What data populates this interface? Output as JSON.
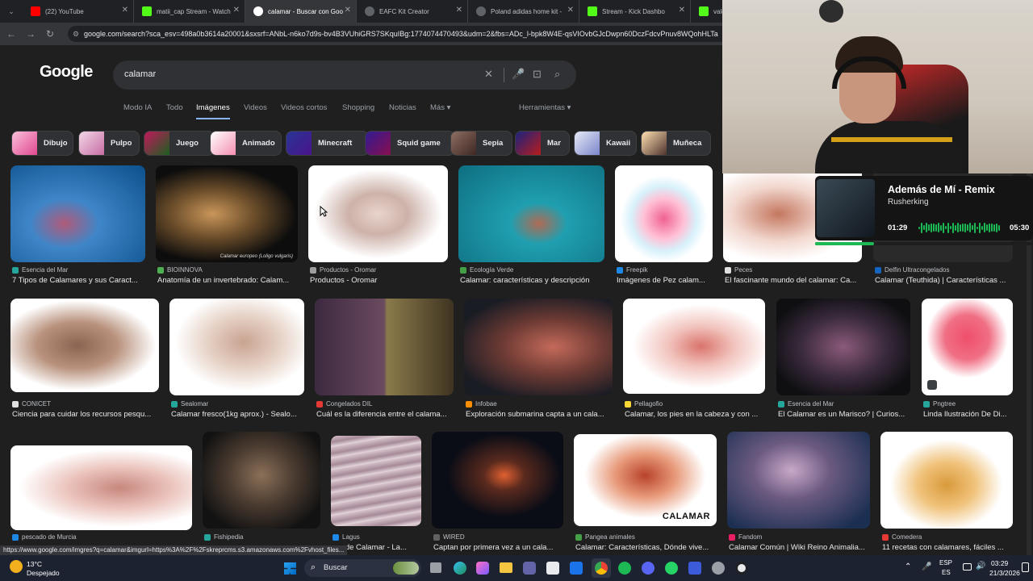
{
  "browser": {
    "tabs": [
      {
        "label": "(22) YouTube",
        "color": "#ff0000"
      },
      {
        "label": "matii_cap Stream - Watch",
        "color": "#53fc18"
      },
      {
        "label": "calamar - Buscar con Goo",
        "color": "#4285f4",
        "active": true
      },
      {
        "label": "EAFC Kit Creator",
        "color": "#9aa0a6"
      },
      {
        "label": "Poland adidas home kit -",
        "color": "#9aa0a6"
      },
      {
        "label": "Stream - Kick Dashbo",
        "color": "#53fc18"
      },
      {
        "label": "vale",
        "color": "#53fc18"
      }
    ],
    "url": "google.com/search?sca_esv=498a0b3614a20001&sxsrf=ANbL-n6ko7d9s-bv4B3VUhiGRS7SKquIBg:1774074470493&udm=2&fbs=ADc_l-bpk8W4E-qsVIOvbGJcDwpn60DczFdcvPnuv8WQohHLTa"
  },
  "google": {
    "logo": "Google",
    "query": "calamar",
    "search_tabs": [
      "Modo IA",
      "Todo",
      "Imágenes",
      "Videos",
      "Videos cortos",
      "Shopping",
      "Noticias",
      "Más ▾"
    ],
    "tools": "Herramientas ▾",
    "chips": [
      "Dibujo",
      "Pulpo",
      "Juego",
      "Animado",
      "Minecraft",
      "Squid game",
      "Sepia",
      "Mar",
      "Kawaii",
      "Muñeca"
    ]
  },
  "results": [
    {
      "source": "Esencia del Mar",
      "title": "7 Tipos de Calamares y sus Caract..."
    },
    {
      "source": "BIOINNOVA",
      "title": "Anatomía de un invertebrado: Calam..."
    },
    {
      "source": "Productos - Oromar",
      "title": "Productos - Oromar"
    },
    {
      "source": "Ecología Verde",
      "title": "Calamar: características y descripción"
    },
    {
      "source": "Freepik",
      "title": "Imágenes de Pez calam..."
    },
    {
      "source": "Peces",
      "title": "El fascinante mundo del calamar: Ca..."
    },
    {
      "source": "Delfin Ultracongelados",
      "title": "Calamar (Teuthida) | Características ..."
    },
    {
      "source": "CONICET",
      "title": "Ciencia para cuidar los recursos pesqu..."
    },
    {
      "source": "Sealomar",
      "title": "Calamar fresco(1kg aprox.) - Sealo..."
    },
    {
      "source": "Congelados DIL",
      "title": "Cuál es la diferencia entre el calama..."
    },
    {
      "source": "Infobae",
      "title": "Exploración submarina capta a un cala..."
    },
    {
      "source": "Pellagofio",
      "title": "Calamar, los pies en la cabeza y con ..."
    },
    {
      "source": "Esencia del Mar",
      "title": "El Calamar es un Marisco? | Curios..."
    },
    {
      "source": "Pngtree",
      "title": "Linda Ilustración De Di..."
    },
    {
      "source": "pescado de Murcia",
      "title": ""
    },
    {
      "source": "Fishipedia",
      "title": ""
    },
    {
      "source": "Lagus",
      "title": "...o de Calamar - La..."
    },
    {
      "source": "WIRED",
      "title": "Captan por primera vez a un cala..."
    },
    {
      "source": "Pangea animales",
      "title": "Calamar: Características, Dónde vive..."
    },
    {
      "source": "Fandom",
      "title": "Calamar Común | Wiki Reino Animalia..."
    },
    {
      "source": "Comedera",
      "title": "11 recetas con calamares, fáciles ..."
    }
  ],
  "image_overlays": {
    "bioinnova_caption": "Calamar europeo (Loligo vulgaris)",
    "pangea_caption": "CALAMAR"
  },
  "status_url": "https://www.google.com/imgres?q=calamar&imgurl=https%3A%2F%2Fskreprcms.s3.amazonaws.com%2Fvhost_files...",
  "taskbar": {
    "weather_temp": "13°C",
    "weather_desc": "Despejado",
    "search_label": "Buscar",
    "lang": "ESP",
    "lang_sub": "ES",
    "time": "03:29",
    "date": "21/3/2026"
  },
  "now_playing": {
    "title": "Además de Mí - Remix",
    "artist": "Rusherking",
    "elapsed": "01:29",
    "duration": "05:30",
    "progress": 0.27
  }
}
